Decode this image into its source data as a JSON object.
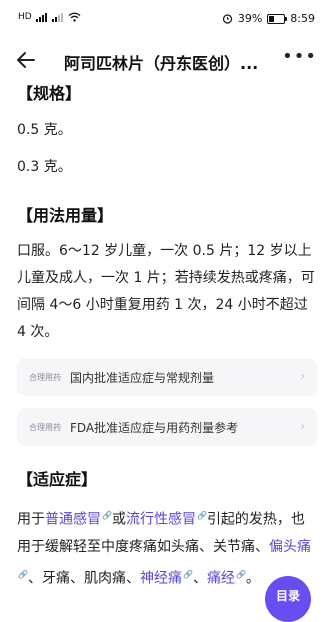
{
  "status_bar": {
    "network_label": "HD",
    "battery_percent_label": "39%",
    "battery_level": 0.39,
    "time": "8:59"
  },
  "header": {
    "title": "阿司匹林片（丹东医创）..."
  },
  "spec": {
    "title": "【规格】",
    "items": [
      "0.5 克。",
      "0.3 克。"
    ]
  },
  "dosage": {
    "title": "【用法用量】",
    "text": "口服。6～12 岁儿童，一次 0.5 片；12 岁以上儿童及成人，一次 1 片；若持续发热或疼痛，可间隔 4～6 小时重复用药 1 次，24 小时不超过 4 次。",
    "cards": [
      {
        "tag": "合理用药",
        "label": "国内批准适应症与常规剂量"
      },
      {
        "tag": "合理用药",
        "label": "FDA批准适应症与用药剂量参考"
      }
    ]
  },
  "indications": {
    "title": "【适应症】",
    "t1": "用于",
    "link1": "普通感冒",
    "t2": "或",
    "link2": "流行性感冒",
    "t3": "引起的发热，也用于缓解轻至中度疼痛如头痛、关节痛、",
    "link3": "偏头痛",
    "t4": "、牙痛、肌肉痛、",
    "link4": "神经痛",
    "t5": "、",
    "link5": "痛经",
    "t6": "。"
  },
  "toc_button": {
    "label": "目录"
  }
}
